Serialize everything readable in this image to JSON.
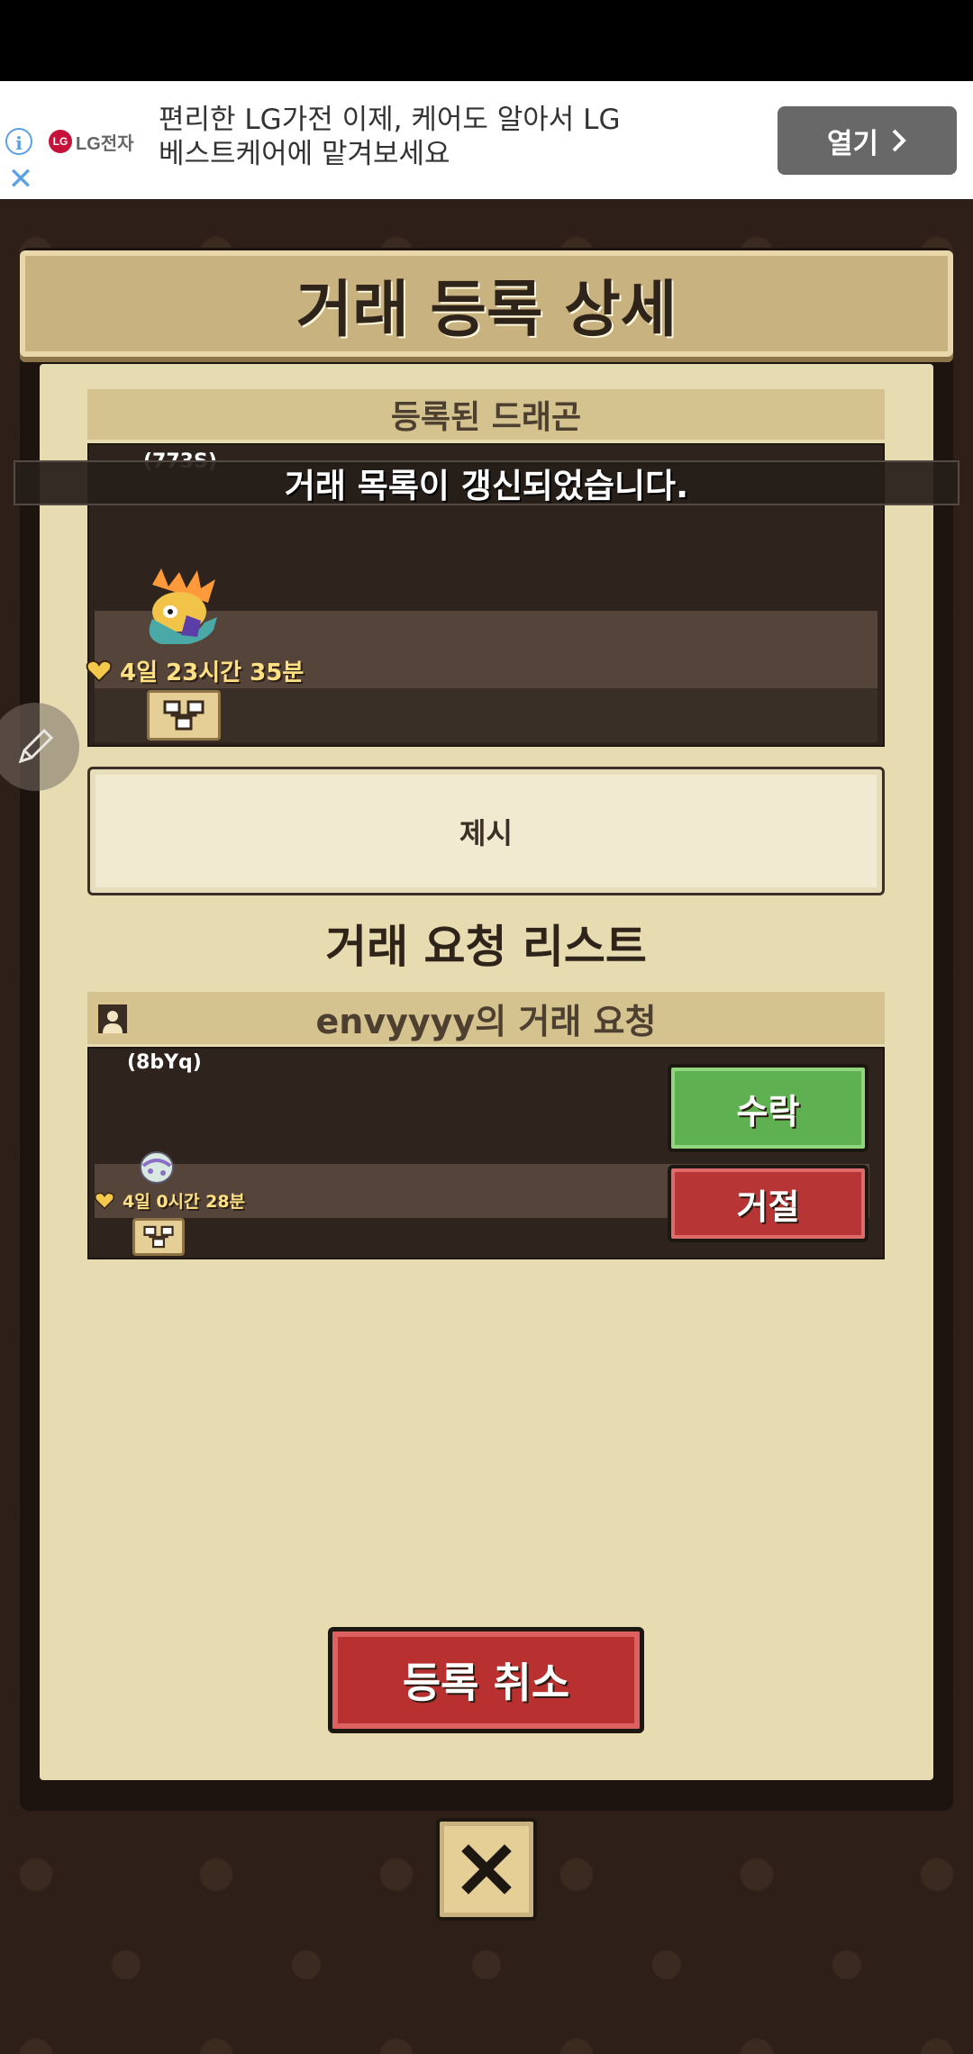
{
  "ad": {
    "info_label": "i",
    "close_label": "✕",
    "brand": "LG전자",
    "brand_mark": "LG",
    "headline": "편리한 LG가전 이제, 케어도 알아서 LG 베스트케어에 맡겨보세요",
    "open_label": "열기"
  },
  "dialog": {
    "title": "거래 등록 상세",
    "registered_header": "등록된 드래곤",
    "registered_dragon": {
      "code": "(773S)",
      "timer": "4일 23시간 35분"
    },
    "toast": "거래 목록이 갱신되었습니다.",
    "offer_label": "제시",
    "requests_title": "거래 요청 리스트",
    "request": {
      "header": "envyyyy의 거래 요청",
      "code": "(8bYq)",
      "timer": "4일 0시간 28분",
      "accept_label": "수락",
      "reject_label": "거절"
    },
    "cancel_label": "등록 취소"
  },
  "colors": {
    "accept": "#5eb050",
    "reject": "#b73535",
    "panel": "#e7dbb1",
    "background": "#2e2019"
  }
}
